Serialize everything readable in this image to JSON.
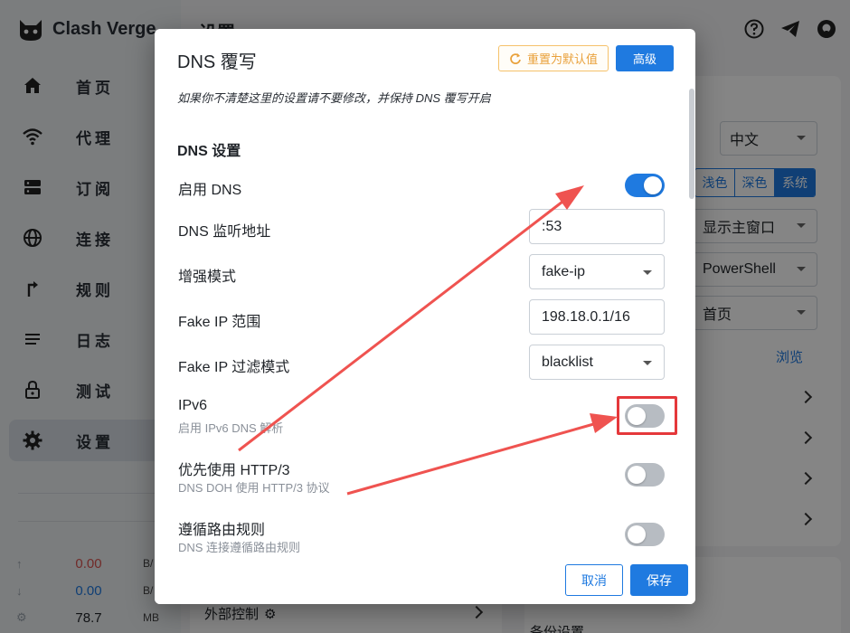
{
  "app": {
    "name": "Clash Verge",
    "page_title": "设置",
    "nav": [
      {
        "label": "首页",
        "icon": "home-icon",
        "active": false
      },
      {
        "label": "代理",
        "icon": "wifi-icon",
        "active": false
      },
      {
        "label": "订阅",
        "icon": "server-icon",
        "active": false
      },
      {
        "label": "连接",
        "icon": "globe-icon",
        "active": false
      },
      {
        "label": "规则",
        "icon": "route-icon",
        "active": false
      },
      {
        "label": "日志",
        "icon": "list-icon",
        "active": false
      },
      {
        "label": "测试",
        "icon": "lock-icon",
        "active": false
      },
      {
        "label": "设置",
        "icon": "gear-icon",
        "active": true
      }
    ],
    "traffic": {
      "up": {
        "value": "0.00",
        "unit": "B/"
      },
      "down": {
        "value": "0.00",
        "unit": "B/"
      },
      "memory": {
        "value": "78.7",
        "unit": "MB"
      }
    },
    "settings": {
      "language": "中文",
      "theme_options": [
        "浅色",
        "深色",
        "系统"
      ],
      "tray_action": "显示主窗口",
      "terminal": "PowerShell",
      "start_page": "首页",
      "browse_label": "浏览",
      "external_control": "外部控制",
      "backup_settings": "备份设置"
    }
  },
  "dialog": {
    "title": "DNS 覆写",
    "reset_label": "重置为默认值",
    "advanced_label": "高级",
    "notice": "如果你不清楚这里的设置请不要修改，并保持 DNS 覆写开启",
    "section_title": "DNS 设置",
    "enable_dns": {
      "label": "启用 DNS",
      "on": true
    },
    "listen": {
      "label": "DNS 监听地址",
      "value": ":53"
    },
    "enhanced_mode": {
      "label": "增强模式",
      "value": "fake-ip"
    },
    "fake_ip_range": {
      "label": "Fake IP 范围",
      "value": "198.18.0.1/16"
    },
    "fake_ip_filter_mode": {
      "label": "Fake IP 过滤模式",
      "value": "blacklist"
    },
    "ipv6": {
      "label": "IPv6",
      "sub": "启用 IPv6 DNS 解析",
      "on": false
    },
    "http3": {
      "label": "优先使用 HTTP/3",
      "sub": "DNS DOH 使用 HTTP/3 协议",
      "on": false
    },
    "follow_rules": {
      "label": "遵循路由规则",
      "sub": "DNS 连接遵循路由规则",
      "on": false
    },
    "cancel_label": "取消",
    "save_label": "保存"
  },
  "colors": {
    "accent": "#1f7ae0",
    "reset_border": "#f5c26b",
    "annotation": "#e5383b"
  }
}
